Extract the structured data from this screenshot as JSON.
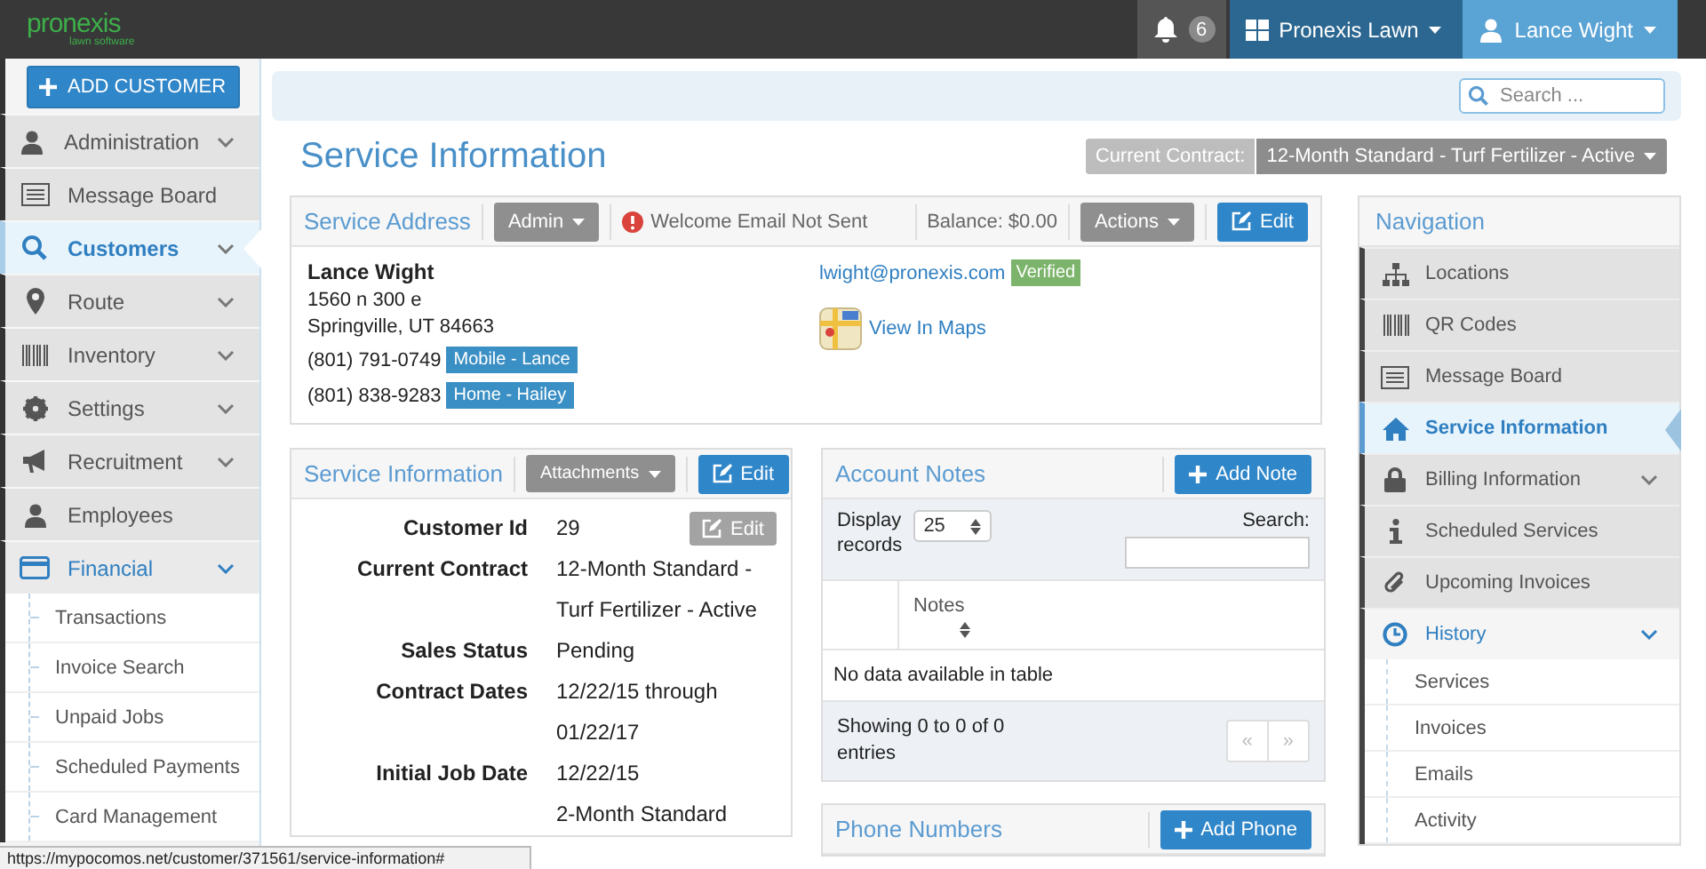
{
  "topbar": {
    "logo": "pronexis",
    "logo_tagline": "lawn software",
    "notifications": "6",
    "company": "Pronexis Lawn",
    "user": "Lance Wight"
  },
  "sidebar": {
    "add_button": "ADD CUSTOMER",
    "items": [
      {
        "label": "Administration",
        "kind": "group",
        "selected": false,
        "expanded": false
      },
      {
        "label": "Message Board",
        "kind": "link",
        "selected": false
      },
      {
        "label": "Customers",
        "kind": "group",
        "selected": true,
        "expanded": false
      },
      {
        "label": "Route",
        "kind": "group",
        "selected": false,
        "expanded": false
      },
      {
        "label": "Inventory",
        "kind": "group",
        "selected": false,
        "expanded": false
      },
      {
        "label": "Settings",
        "kind": "group",
        "selected": false,
        "expanded": false
      },
      {
        "label": "Recruitment",
        "kind": "group",
        "selected": false,
        "expanded": false
      },
      {
        "label": "Employees",
        "kind": "link",
        "selected": false
      },
      {
        "label": "Financial",
        "kind": "group",
        "selected": false,
        "expanded": true,
        "children": [
          {
            "label": "Transactions"
          },
          {
            "label": "Invoice Search"
          },
          {
            "label": "Unpaid Jobs"
          },
          {
            "label": "Scheduled Payments"
          },
          {
            "label": "Card Management"
          }
        ]
      }
    ]
  },
  "search": {
    "placeholder": "Search ..."
  },
  "page_title": "Service Information",
  "current_contract": {
    "label": "Current Contract:",
    "value": "12-Month Standard - Turf Fertilizer - Active"
  },
  "service_address": {
    "title": "Service Address",
    "admin_button": "Admin",
    "warning": "Welcome Email Not Sent",
    "balance": "Balance: $0.00",
    "actions_button": "Actions",
    "edit_button": "Edit",
    "name": "Lance Wight",
    "address_lines": [
      "1560 n 300 e",
      "Springville, UT 84663"
    ],
    "phones": [
      {
        "number": "(801) 791-0749",
        "tag": "Mobile - Lance"
      },
      {
        "number": "(801) 838-9283",
        "tag": "Home - Hailey"
      }
    ],
    "email": "lwight@pronexis.com",
    "email_status": "Verified",
    "maps_link": "View In Maps"
  },
  "service_information": {
    "title": "Service Information",
    "attachments_button": "Attachments",
    "edit_button": "Edit",
    "inner_edit_button": "Edit",
    "fields": [
      {
        "label": "Customer Id",
        "value": "29"
      },
      {
        "label": "Current Contract",
        "value": "12-Month Standard - Turf Fertilizer - Active"
      },
      {
        "label": "Sales Status",
        "value": "Pending"
      },
      {
        "label": "Contract Dates",
        "value": "12/22/15 through 01/22/17"
      },
      {
        "label": "Initial Job Date",
        "value": "12/22/15"
      },
      {
        "value": "2-Month Standard"
      }
    ]
  },
  "account_notes": {
    "title": "Account Notes",
    "add_button": "Add Note",
    "display_label": "Display",
    "records_label": "records",
    "page_size": "25",
    "search_label": "Search:",
    "columns": [
      "Notes"
    ],
    "empty_message": "No data available in table",
    "info": "Showing 0 to 0 of 0 entries",
    "prev": "«",
    "next": "»",
    "pager_disabled": true
  },
  "phone_numbers": {
    "title": "Phone Numbers",
    "add_button": "Add Phone"
  },
  "navigation": {
    "title": "Navigation",
    "items": [
      {
        "label": "Locations",
        "kind": "link",
        "selected": false
      },
      {
        "label": "QR Codes",
        "kind": "link",
        "selected": false
      },
      {
        "label": "Message Board",
        "kind": "link",
        "selected": false
      },
      {
        "label": "Service Information",
        "kind": "link",
        "selected": true
      },
      {
        "label": "Billing Information",
        "kind": "group",
        "selected": false,
        "expanded": false
      },
      {
        "label": "Scheduled Services",
        "kind": "link",
        "selected": false
      },
      {
        "label": "Upcoming Invoices",
        "kind": "link",
        "selected": false
      },
      {
        "label": "History",
        "kind": "group",
        "selected": false,
        "expanded": true,
        "children": [
          {
            "label": "Services"
          },
          {
            "label": "Invoices"
          },
          {
            "label": "Emails"
          },
          {
            "label": "Activity"
          }
        ]
      }
    ]
  },
  "status_url": "https://mypocomos.net/customer/371561/service-information#"
}
